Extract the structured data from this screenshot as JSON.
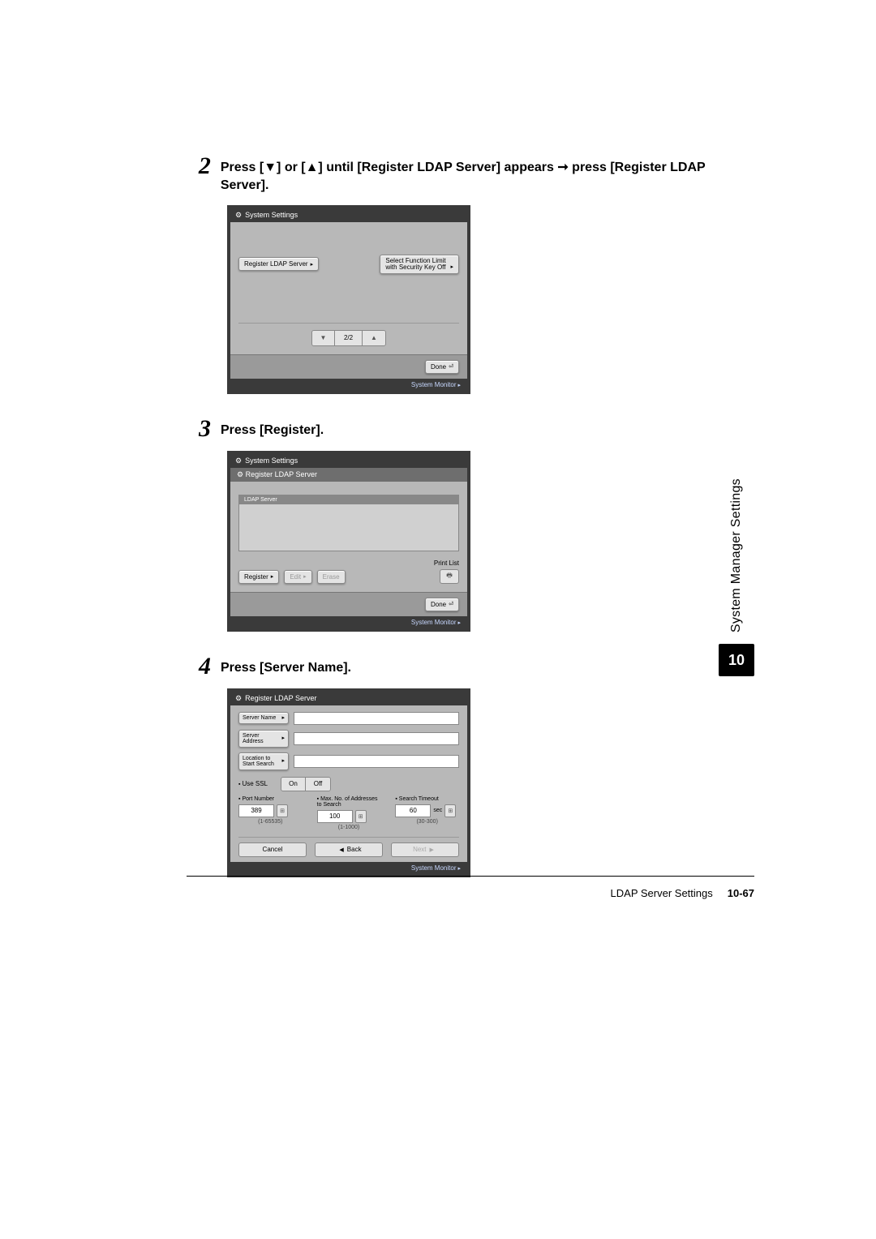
{
  "steps": {
    "2": {
      "num": "2",
      "text": "Press [▼] or [▲] until [Register LDAP Server] appears ➞ press [Register LDAP Server]."
    },
    "3": {
      "num": "3",
      "text": "Press [Register]."
    },
    "4": {
      "num": "4",
      "text": "Press [Server Name]."
    }
  },
  "shot1": {
    "title": "System Settings",
    "register_btn": "Register LDAP Server",
    "func_limit_line1": "Select Function Limit",
    "func_limit_line2": "with Security Key Off",
    "page_count": "2/2",
    "done": "Done",
    "sysmon": "System Monitor"
  },
  "shot2": {
    "title": "System Settings",
    "subtitle": "Register LDAP Server",
    "list_header": "LDAP Server",
    "register": "Register",
    "edit": "Edit",
    "erase": "Erase",
    "print_list": "Print List",
    "done": "Done",
    "sysmon": "System Monitor"
  },
  "shot3": {
    "title": "Register LDAP Server",
    "server_name": "Server Name",
    "server_address": "Server Address",
    "location": "Location to Start Search",
    "use_ssl": "Use SSL",
    "on": "On",
    "off": "Off",
    "port_number": "Port Number",
    "max_addr": "Max. No. of Addresses to Search",
    "search_timeout": "Search Timeout",
    "port_val": "389",
    "port_range": "(1-65535)",
    "max_val": "100",
    "max_range": "(1-1000)",
    "timeout_val": "60",
    "timeout_unit": "sec",
    "timeout_range": "(30-300)",
    "cancel": "Cancel",
    "back": "Back",
    "next": "Next",
    "sysmon": "System Monitor"
  },
  "sidebar": {
    "label": "System Manager Settings",
    "chapter": "10"
  },
  "footer": {
    "section": "LDAP Server Settings",
    "page": "10-67"
  }
}
